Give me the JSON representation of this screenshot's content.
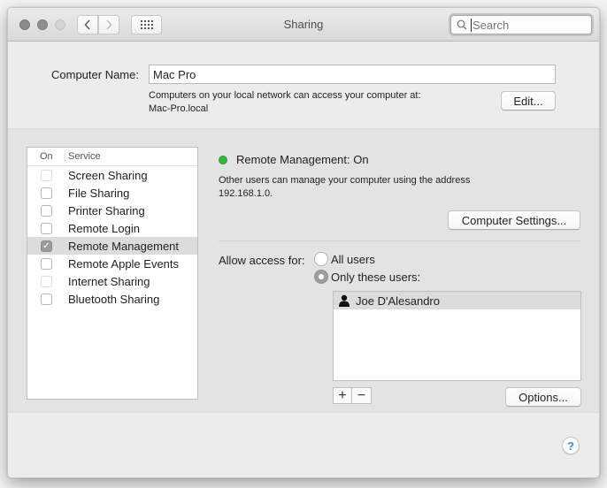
{
  "window": {
    "title": "Sharing",
    "search": {
      "placeholder": "Search",
      "value": ""
    }
  },
  "toolbar": {
    "back_icon": "chevron-left-icon",
    "forward_icon": "chevron-right-icon",
    "show_all_icon": "grid-icon"
  },
  "computer_name": {
    "label": "Computer Name:",
    "value": "Mac Pro",
    "description_line1": "Computers on your local network can access your computer at:",
    "description_line2": "Mac-Pro.local",
    "edit_button": "Edit..."
  },
  "services": {
    "header_on": "On",
    "header_service": "Service",
    "items": [
      {
        "label": "Screen Sharing",
        "checked": false,
        "enabled": false
      },
      {
        "label": "File Sharing",
        "checked": false,
        "enabled": true
      },
      {
        "label": "Printer Sharing",
        "checked": false,
        "enabled": true
      },
      {
        "label": "Remote Login",
        "checked": false,
        "enabled": true
      },
      {
        "label": "Remote Management",
        "checked": true,
        "enabled": true,
        "selected": true
      },
      {
        "label": "Remote Apple Events",
        "checked": false,
        "enabled": true
      },
      {
        "label": "Internet Sharing",
        "checked": false,
        "enabled": false
      },
      {
        "label": "Bluetooth Sharing",
        "checked": false,
        "enabled": true
      }
    ]
  },
  "detail": {
    "status_color": "#2bbd3a",
    "status_text": "Remote Management: On",
    "description_line1": "Other users can manage your computer using the address",
    "description_line2": "192.168.1.0.",
    "computer_settings_button": "Computer Settings...",
    "allow_access_label": "Allow access for:",
    "radio_all_users": "All users",
    "radio_only_these": "Only these users:",
    "selected_access": "Only these users:",
    "users": [
      {
        "name": "Joe D'Alesandro",
        "icon": "user-icon"
      }
    ],
    "add_button": "+",
    "remove_button": "−",
    "options_button": "Options..."
  },
  "help_button": "?"
}
